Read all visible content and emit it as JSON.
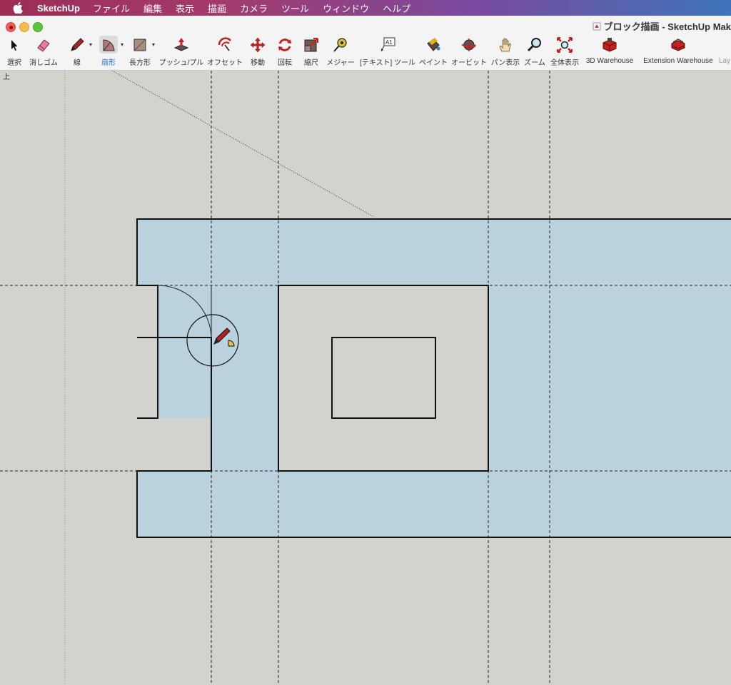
{
  "menubar": {
    "apple_icon": "apple-icon",
    "app_name": "SketchUp",
    "items": [
      "ファイル",
      "編集",
      "表示",
      "描画",
      "カメラ",
      "ツール",
      "ウィンドウ",
      "ヘルプ"
    ]
  },
  "window": {
    "title": "ブロック描画 - SketchUp Mak",
    "doc_icon": "document-icon"
  },
  "toolbar": {
    "tools": [
      {
        "label": "選択",
        "icon": "select-arrow-icon"
      },
      {
        "label": "消しゴム",
        "icon": "eraser-icon"
      },
      {
        "label": "線",
        "icon": "pencil-icon"
      },
      {
        "label": "扇形",
        "icon": "arc-pie-icon",
        "active": true
      },
      {
        "label": "長方形",
        "icon": "rectangle-icon"
      },
      {
        "label": "プッシュ/プル",
        "icon": "push-pull-icon"
      },
      {
        "label": "オフセット",
        "icon": "offset-icon"
      },
      {
        "label": "移動",
        "icon": "move-icon"
      },
      {
        "label": "回転",
        "icon": "rotate-icon"
      },
      {
        "label": "縮尺",
        "icon": "scale-icon"
      },
      {
        "label": "メジャー",
        "icon": "tape-measure-icon"
      },
      {
        "label": "[テキスト] ツール",
        "icon": "text-tool-icon"
      },
      {
        "label": "ペイント",
        "icon": "paint-bucket-icon"
      },
      {
        "label": "オービット",
        "icon": "orbit-icon"
      },
      {
        "label": "パン表示",
        "icon": "pan-hand-icon"
      },
      {
        "label": "ズーム",
        "icon": "zoom-icon"
      },
      {
        "label": "全体表示",
        "icon": "zoom-extents-icon"
      },
      {
        "label": "3D Warehouse",
        "icon": "3d-warehouse-icon"
      },
      {
        "label": "Extension Warehouse",
        "icon": "extension-warehouse-icon"
      },
      {
        "label": "Lay",
        "icon": "layout-icon"
      }
    ]
  },
  "viewport": {
    "view_label": "上",
    "face_color": "#b9d2dd",
    "background_color": "#d3d3cd",
    "cursor_icon": "pencil-pie-cursor-icon"
  }
}
